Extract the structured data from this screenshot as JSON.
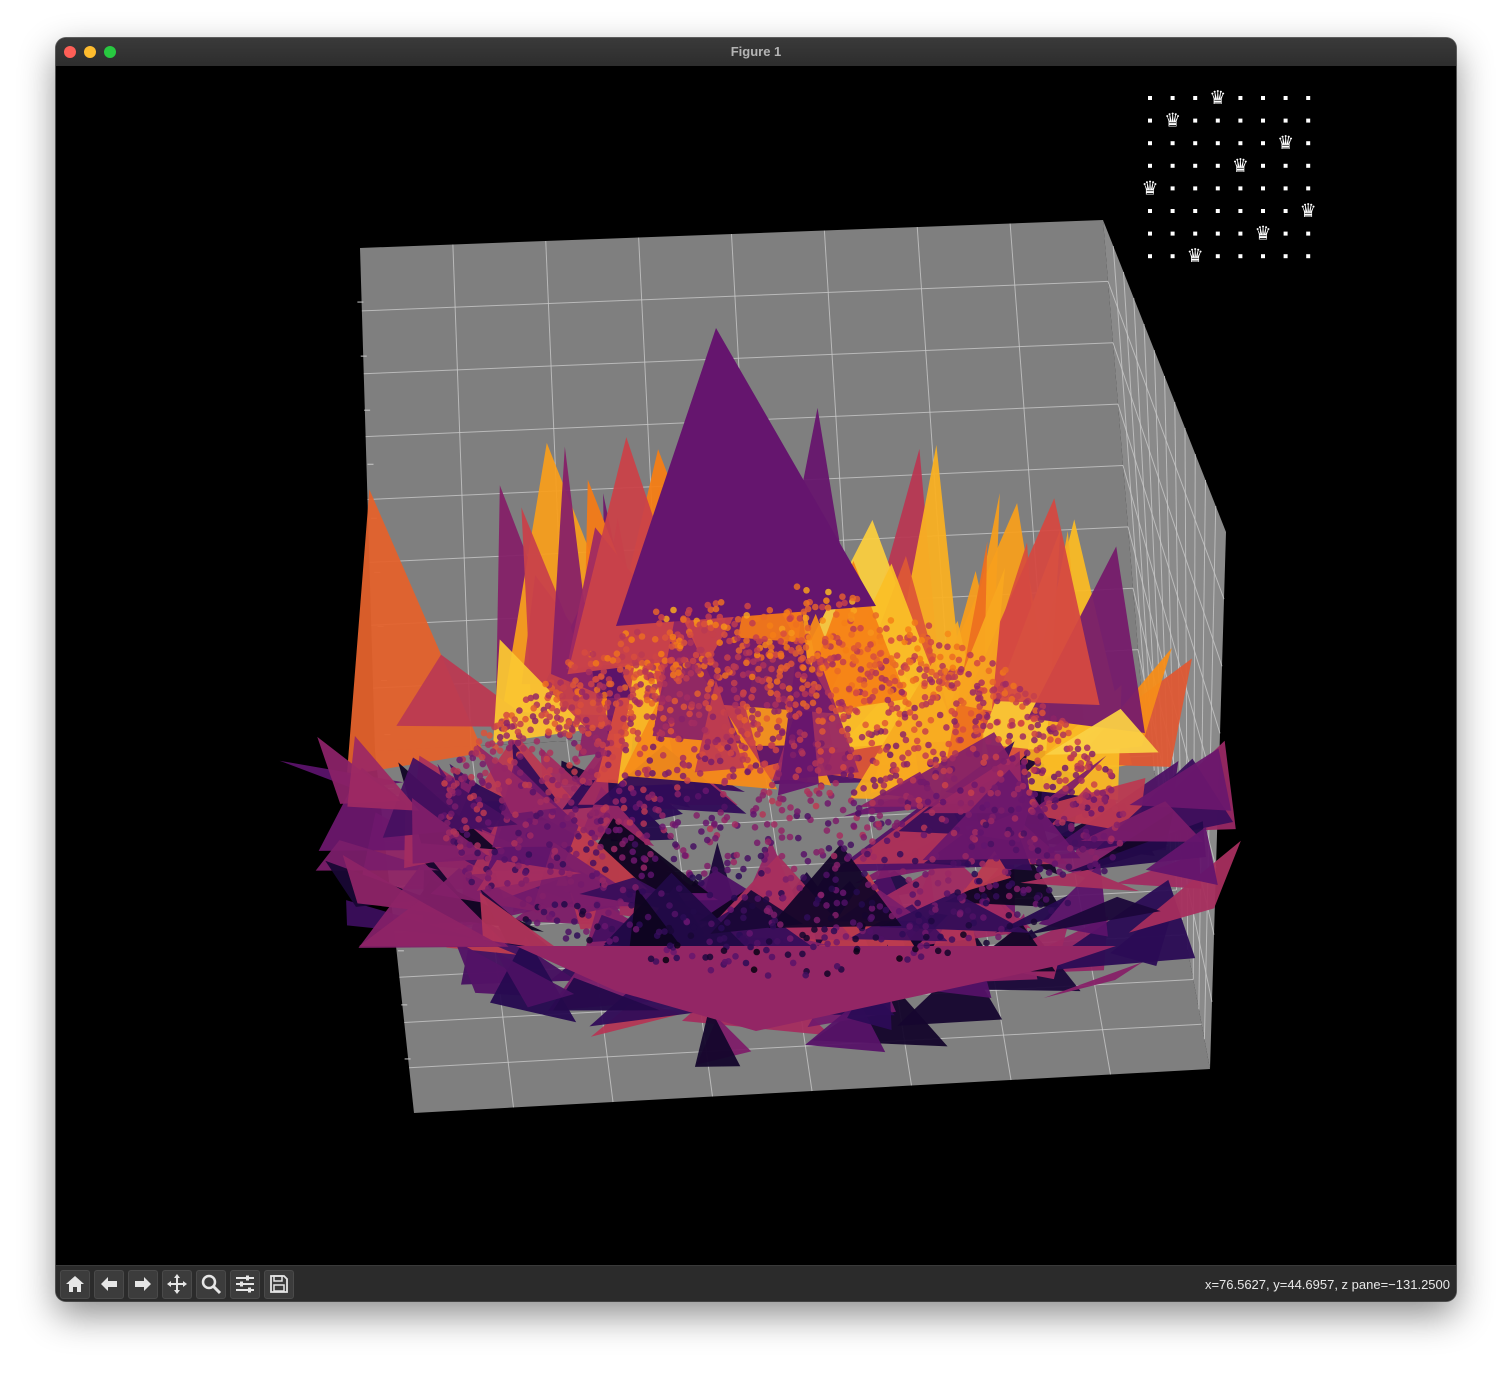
{
  "window": {
    "title": "Figure 1"
  },
  "toolbar": {
    "buttons": [
      {
        "name": "home-button",
        "icon": "home-icon"
      },
      {
        "name": "back-button",
        "icon": "arrow-left-icon"
      },
      {
        "name": "forward-button",
        "icon": "arrow-right-icon"
      },
      {
        "name": "pan-button",
        "icon": "move-icon"
      },
      {
        "name": "zoom-button",
        "icon": "magnifier-icon"
      },
      {
        "name": "configure-subplots-button",
        "icon": "sliders-icon"
      },
      {
        "name": "save-button",
        "icon": "floppy-disk-icon"
      }
    ],
    "coords": "x=76.5627, y=44.6957, z pane=−131.2500"
  },
  "figure": {
    "background": "#000000",
    "pane_color": "#7f7f7f",
    "grid_color": "#c8c8c8",
    "colormap": "inferno"
  },
  "chessboard": {
    "size": 8,
    "queen_columns": [
      3,
      1,
      6,
      4,
      0,
      7,
      5,
      2
    ],
    "piece_glyph": "♛",
    "color": "#ffffff"
  }
}
